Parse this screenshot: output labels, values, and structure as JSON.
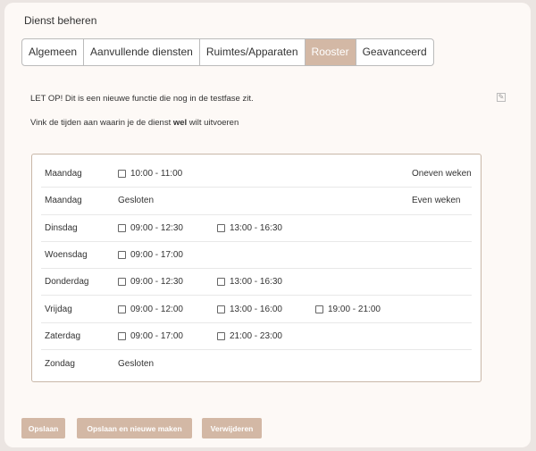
{
  "title": "Dienst beheren",
  "tabs": [
    {
      "label": "Algemeen"
    },
    {
      "label": "Aanvullende diensten"
    },
    {
      "label": "Ruimtes/Apparaten"
    },
    {
      "label": "Rooster"
    },
    {
      "label": "Geavanceerd"
    }
  ],
  "active_tab": "Rooster",
  "notice": "LET OP! Dit is een nieuwe functie die nog in de testfase zit.",
  "instruction": {
    "before": "Vink de tijden aan waarin je de dienst ",
    "bold": "wel",
    "after": " wilt uitvoeren"
  },
  "schedule": [
    {
      "day": "Maandag",
      "slots": [
        "10:00 - 11:00"
      ],
      "closed": null,
      "weeks": "Oneven weken"
    },
    {
      "day": "Maandag",
      "slots": [],
      "closed": "Gesloten",
      "weeks": "Even weken"
    },
    {
      "day": "Dinsdag",
      "slots": [
        "09:00 - 12:30",
        "13:00 - 16:30"
      ],
      "closed": null,
      "weeks": null
    },
    {
      "day": "Woensdag",
      "slots": [
        "09:00 - 17:00"
      ],
      "closed": null,
      "weeks": null
    },
    {
      "day": "Donderdag",
      "slots": [
        "09:00 - 12:30",
        "13:00 - 16:30"
      ],
      "closed": null,
      "weeks": null
    },
    {
      "day": "Vrijdag",
      "slots": [
        "09:00 - 12:00",
        "13:00 - 16:00",
        "19:00 - 21:00"
      ],
      "closed": null,
      "weeks": null
    },
    {
      "day": "Zaterdag",
      "slots": [
        "09:00 - 17:00",
        "21:00 - 23:00"
      ],
      "closed": null,
      "weeks": null
    },
    {
      "day": "Zondag",
      "slots": [],
      "closed": "Gesloten",
      "weeks": null
    }
  ],
  "buttons": {
    "save": "Opslaan",
    "save_new": "Opslaan en nieuwe maken",
    "delete": "Verwijderen"
  },
  "colors": {
    "accent": "#d3b8a5",
    "card": "#fdf9f6",
    "background": "#ebe5e2"
  }
}
